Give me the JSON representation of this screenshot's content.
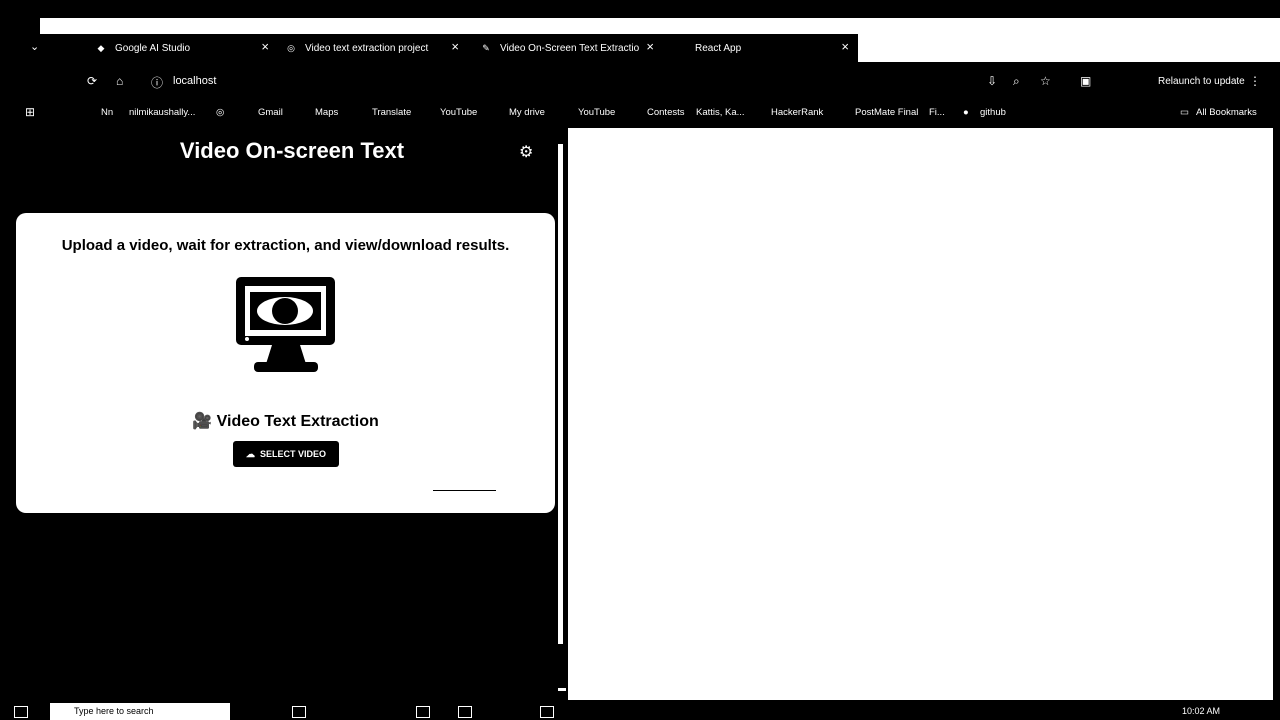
{
  "browser": {
    "tabs": [
      {
        "label": "Google AI Studio",
        "favicon": "diamond-icon"
      },
      {
        "label": "Video text extraction project",
        "favicon": "globe-icon"
      },
      {
        "label": "Video On-Screen Text Extractio",
        "favicon": "pencil-icon"
      },
      {
        "label": "React App",
        "favicon": "react-icon"
      }
    ],
    "url": "localhost",
    "relaunch_label": "Relaunch to update",
    "bookmarks": [
      "Nn",
      "nilmikaushally...",
      "Gmail",
      "Maps",
      "Translate",
      "YouTube",
      "My drive",
      "YouTube",
      "Contests",
      "Kattis, Ka...",
      "HackerRank",
      "PostMate Final",
      "Fi...",
      "github",
      "All Bookmarks"
    ]
  },
  "app": {
    "title": "Video On-screen Text",
    "card_heading": "Upload a video, wait for extraction, and view/download results.",
    "extraction_title": "Video Text Extraction",
    "select_button": "SELECT VIDEO"
  },
  "taskbar": {
    "search_placeholder": "Type here to search",
    "time": "10:02 AM"
  }
}
